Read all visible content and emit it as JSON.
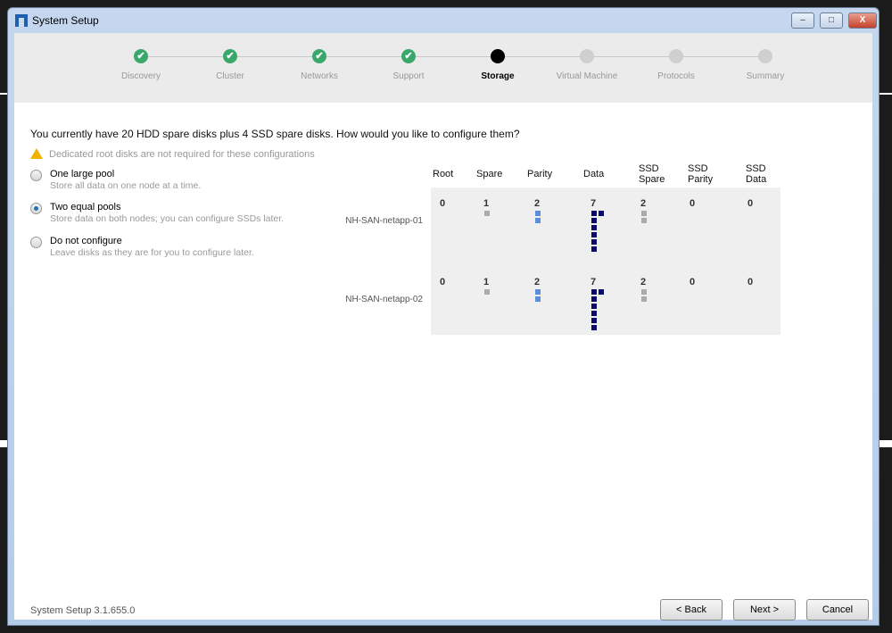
{
  "window": {
    "title": "System Setup",
    "minimize": "–",
    "maximize": "□",
    "close": "X"
  },
  "steps": [
    {
      "label": "Discovery",
      "state": "done"
    },
    {
      "label": "Cluster",
      "state": "done"
    },
    {
      "label": "Networks",
      "state": "done"
    },
    {
      "label": "Support",
      "state": "done"
    },
    {
      "label": "Storage",
      "state": "current"
    },
    {
      "label": "Virtual Machine",
      "state": "pending"
    },
    {
      "label": "Protocols",
      "state": "pending"
    },
    {
      "label": "Summary",
      "state": "pending"
    }
  ],
  "question": "You currently have 20 HDD spare disks plus 4 SSD spare disks. How would you like to configure them?",
  "warning": "Dedicated root disks are not required for these configurations",
  "options": [
    {
      "label": "One large pool",
      "desc": "Store all data on one node at a time.",
      "selected": false
    },
    {
      "label": "Two equal pools",
      "desc": "Store data on both nodes; you can configure SSDs later.",
      "selected": true
    },
    {
      "label": "Do not configure",
      "desc": "Leave disks as they are for you to configure later.",
      "selected": false
    }
  ],
  "columns": [
    "Root",
    "Spare",
    "Parity",
    "Data",
    "SSD\nSpare",
    "SSD\nParity",
    "SSD\nData"
  ],
  "column_colors": [
    "#aaaaaa",
    "#aaaaaa",
    "#5b8fdd",
    "#0a0a6e",
    "#aaaaaa",
    "#aaaaaa",
    "#0a0a6e"
  ],
  "nodes": [
    {
      "name": "NH-SAN-netapp-01",
      "counts": [
        0,
        1,
        2,
        7,
        2,
        0,
        0
      ]
    },
    {
      "name": "NH-SAN-netapp-02",
      "counts": [
        0,
        1,
        2,
        7,
        2,
        0,
        0
      ]
    }
  ],
  "footer": {
    "version": "System Setup 3.1.655.0",
    "back": "< Back",
    "next": "Next >",
    "cancel": "Cancel"
  }
}
